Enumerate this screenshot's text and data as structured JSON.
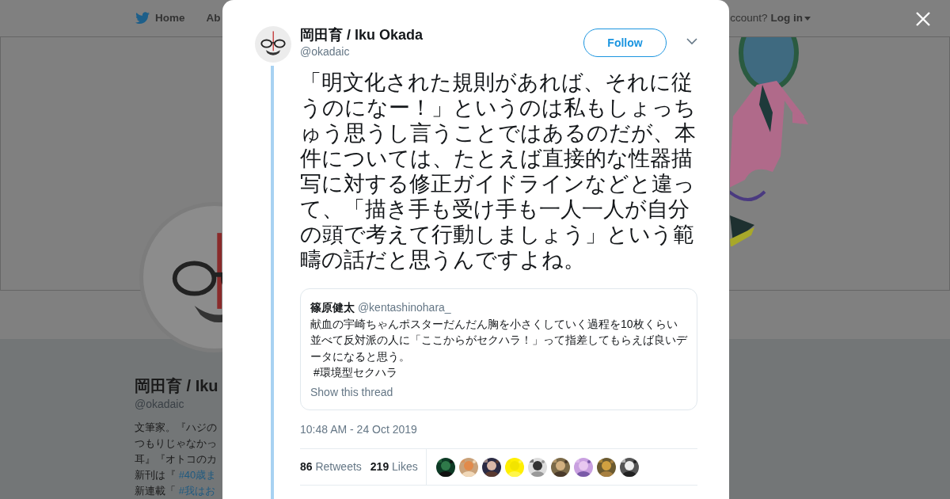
{
  "background_page": {
    "nav": {
      "items": [
        {
          "label": "Home",
          "kind": "home"
        },
        {
          "label": "Ab",
          "kind": "plain"
        }
      ],
      "login_prompt": "ccount?",
      "login": "Log in"
    },
    "profile": {
      "name": "岡田育 / Iku",
      "handle": "@okadaic",
      "bio": [
        {
          "text": "文筆家。『ハジの"
        },
        {
          "text": "つもりじゃなかっ"
        },
        {
          "text": "耳』『オトコのカ"
        },
        {
          "text": "新刊は『",
          "link": "#40歳ま"
        },
        {
          "text": "新連載「",
          "link": "#我はお"
        }
      ]
    }
  },
  "modal": {
    "author": {
      "name": "岡田育 / Iku Okada",
      "handle": "@okadaic"
    },
    "follow_button": "Follow",
    "text": "「明文化された規則があれば、それに従うのになー！」というのは私もしょっちゅう思うし言うことではあるのだが、本件については、たとえば直接的な性器描写に対する修正ガイドラインなどと違って、「描き手も受け手も一人一人が自分の頭で考えて行動しましょう」という範疇の話だと思うんですよね。",
    "quote": {
      "name": "篠原健太",
      "handle": "@kentashinohara_",
      "text": "献血の宇崎ちゃんポスターだんだん胸を小さくしていく過程を10枚くらい並べて反対派の人に「ここからがセクハラ！」って指差してもらえば良いデータになると思う。",
      "hashtag": " #環境型セクハラ",
      "show_thread": "Show this thread"
    },
    "timestamp": "10:48 AM - 24 Oct 2019",
    "stats": [
      {
        "count": "86",
        "label": "Retweets"
      },
      {
        "count": "219",
        "label": "Likes"
      }
    ]
  }
}
